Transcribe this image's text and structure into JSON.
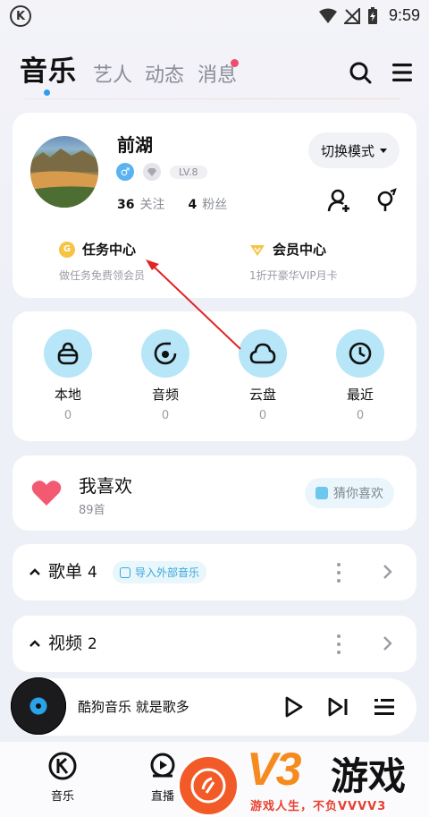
{
  "status_bar": {
    "time": "9:59"
  },
  "header": {
    "tabs": [
      {
        "label": "音乐",
        "active": true
      },
      {
        "label": "艺人",
        "active": false
      },
      {
        "label": "动态",
        "active": false
      },
      {
        "label": "消息",
        "active": false,
        "has_notification": true
      }
    ],
    "icons": [
      "search-icon",
      "menu-icon"
    ]
  },
  "profile": {
    "username": "前湖",
    "level": "LV.8",
    "following_count": "36",
    "following_label": "关注",
    "fans_count": "4",
    "fans_label": "粉丝",
    "switch_mode_label": "切换模式",
    "task_center": {
      "title": "任务中心",
      "subtitle": "做任务免费领会员"
    },
    "vip_center": {
      "title": "会员中心",
      "subtitle": "1折开豪华VIP月卡"
    }
  },
  "quick_access": [
    {
      "label": "本地",
      "count": "0",
      "icon": "bag-icon"
    },
    {
      "label": "音频",
      "count": "0",
      "icon": "audio-icon"
    },
    {
      "label": "云盘",
      "count": "0",
      "icon": "cloud-icon"
    },
    {
      "label": "最近",
      "count": "0",
      "icon": "clock-icon"
    }
  ],
  "favorites": {
    "title": "我喜欢",
    "count": "89首",
    "guess_button": "猜你喜欢"
  },
  "sections": {
    "playlists": {
      "title": "歌单",
      "count": "4",
      "import_label": "导入外部音乐"
    },
    "videos": {
      "title": "视频",
      "count": "2"
    }
  },
  "player": {
    "title": "酷狗音乐  就是歌多"
  },
  "bottom_nav": [
    {
      "label": "音乐",
      "icon": "k-logo-icon"
    },
    {
      "label": "直播",
      "icon": "live-icon"
    }
  ],
  "watermark": {
    "brand_latin": "V3",
    "brand_cn": "游戏",
    "slogan": "游戏人生，不负VVVV3"
  },
  "colors": {
    "accent_blue": "#2d9cf0",
    "icon_bg": "#b6e6f7",
    "notification": "#f04a6c",
    "heart": "#f25a72",
    "annotation_arrow": "#e02424"
  }
}
